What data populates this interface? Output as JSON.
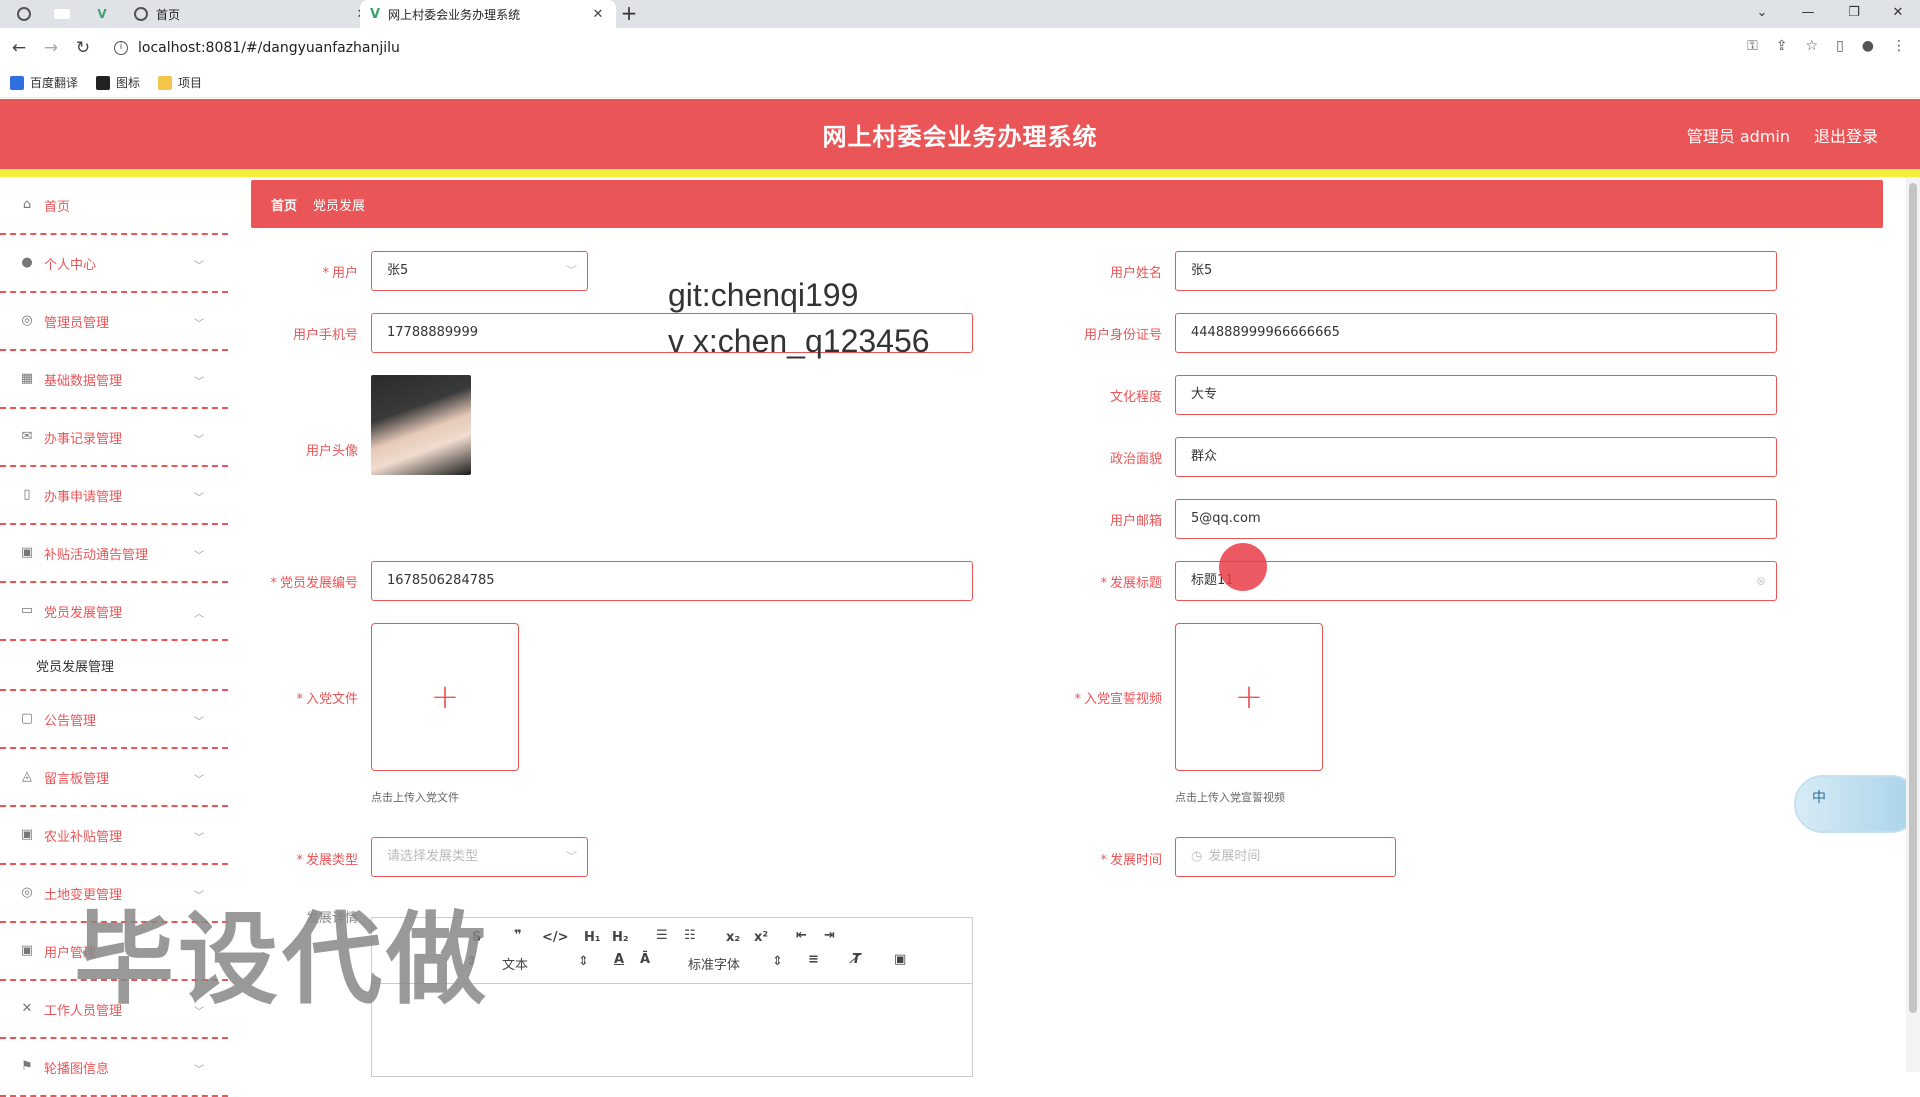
{
  "browser": {
    "tabs": [
      {
        "title": "首页",
        "active": false
      },
      {
        "title": "网上村委会业务办理系统",
        "active": true
      }
    ],
    "url": "localhost:8081/#/dangyuanfazhanjilu",
    "bookmarks": [
      "百度翻译",
      "图标",
      "项目"
    ]
  },
  "header": {
    "title": "网上村委会业务办理系统",
    "user": "管理员 admin",
    "logout": "退出登录"
  },
  "sidebar": {
    "items": [
      {
        "label": "首页",
        "icon": "home-icon"
      },
      {
        "label": "个人中心",
        "icon": "user-icon"
      },
      {
        "label": "管理员管理",
        "icon": "admin-icon"
      },
      {
        "label": "基础数据管理",
        "icon": "grid-icon"
      },
      {
        "label": "办事记录管理",
        "icon": "mail-icon"
      },
      {
        "label": "办事申请管理",
        "icon": "phone-icon"
      },
      {
        "label": "补贴活动通告管理",
        "icon": "clipboard-icon"
      },
      {
        "label": "党员发展管理",
        "icon": "monitor-icon"
      },
      {
        "label": "公告管理",
        "icon": "chat-icon"
      },
      {
        "label": "留言板管理",
        "icon": "bell-icon"
      },
      {
        "label": "农业补贴管理",
        "icon": "clipboard-icon"
      },
      {
        "label": "土地变更管理",
        "icon": "target-icon"
      },
      {
        "label": "用户管理",
        "icon": "clipboard-icon"
      },
      {
        "label": "工作人员管理",
        "icon": "tools-icon"
      },
      {
        "label": "轮播图信息",
        "icon": "flag-icon"
      }
    ],
    "submenu": "党员发展管理"
  },
  "breadcrumb": {
    "home": "首页",
    "current": "党员发展"
  },
  "form": {
    "user_label": "用户",
    "user_value": "张5",
    "username_label": "用户姓名",
    "username_value": "张5",
    "phone_label": "用户手机号",
    "phone_value": "17788889999",
    "idcard_label": "用户身份证号",
    "idcard_value": "444888999966666665",
    "education_label": "文化程度",
    "education_value": "大专",
    "political_label": "政治面貌",
    "political_value": "群众",
    "avatar_label": "用户头像",
    "email_label": "用户邮箱",
    "email_value": "5@qq.com",
    "devno_label": "党员发展编号",
    "devno_value": "1678506284785",
    "devtitle_label": "发展标题",
    "devtitle_value": "标题11",
    "joinfile_label": "入党文件",
    "joinfile_hint": "点击上传入党文件",
    "video_label": "入党宣誓视频",
    "video_hint": "点击上传入党宣誓视频",
    "devtype_label": "发展类型",
    "devtype_placeholder": "请选择发展类型",
    "devtime_label": "发展时间",
    "devtime_placeholder": "发展时间",
    "detail_label": "发展详情"
  },
  "editor": {
    "toolbar_row2": [
      "文本",
      "标准字体"
    ]
  },
  "watermarks": {
    "git": "git:chenqi199",
    "vx": "v x:chen_q123456",
    "big": "毕设代做"
  },
  "float_widget": "中"
}
